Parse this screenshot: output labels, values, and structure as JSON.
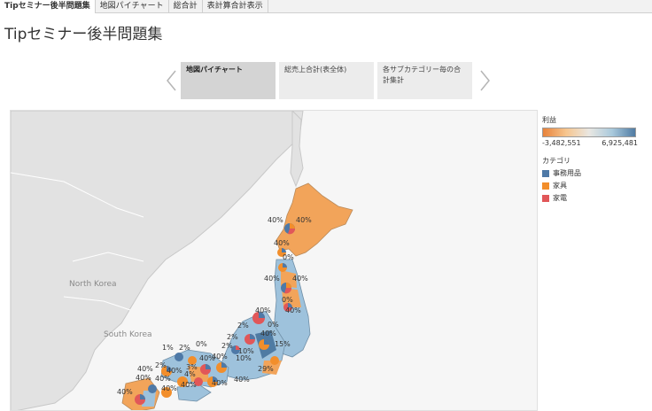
{
  "tabs": [
    {
      "label": "Tipセミナー後半問題集",
      "active": true
    },
    {
      "label": "地図パイチャート",
      "active": false
    },
    {
      "label": "総合計",
      "active": false
    },
    {
      "label": "表計算合計表示",
      "active": false
    }
  ],
  "page_title": "Tipセミナー後半問題集",
  "story_points": [
    {
      "label": "地図パイチャート",
      "active": true
    },
    {
      "label": "総売上合計(表全体)",
      "active": false
    },
    {
      "label": "各サブカテゴリー毎の合計集計",
      "active": false
    }
  ],
  "story_nav": {
    "prev_icon": "chevron-left-icon",
    "next_icon": "chevron-right-icon"
  },
  "map": {
    "country_labels": {
      "north_korea": "North Korea",
      "south_korea": "South Korea"
    },
    "pie_labels": [
      "40%",
      "40%",
      "40%",
      "0%",
      "40%",
      "40%",
      "0%",
      "40%",
      "40%",
      "2%",
      "40%",
      "2%",
      "15%",
      "1%",
      "2%",
      "0%",
      "2%",
      "10%",
      "40%",
      "3%",
      "40%",
      "2%",
      "40%",
      "40%",
      "40%",
      "40%",
      "40%",
      "0%",
      "29%",
      "40%",
      "40%",
      "40%",
      "4%",
      "40%",
      "10%"
    ]
  },
  "legend": {
    "profit_title": "利益",
    "profit_min": "-3,482,551",
    "profit_max": "6,925,481",
    "category_title": "カテゴリ",
    "categories": [
      {
        "label": "事務用品",
        "color": "#4e79a7"
      },
      {
        "label": "家具",
        "color": "#f28e2b"
      },
      {
        "label": "家電",
        "color": "#e15759"
      }
    ]
  },
  "colors": {
    "negative": "#f2a45a",
    "positive": "#9ec2dc",
    "strong_positive": "#4f7ba3",
    "land": "#dcdcdc",
    "sea": "#f4f4f4"
  }
}
